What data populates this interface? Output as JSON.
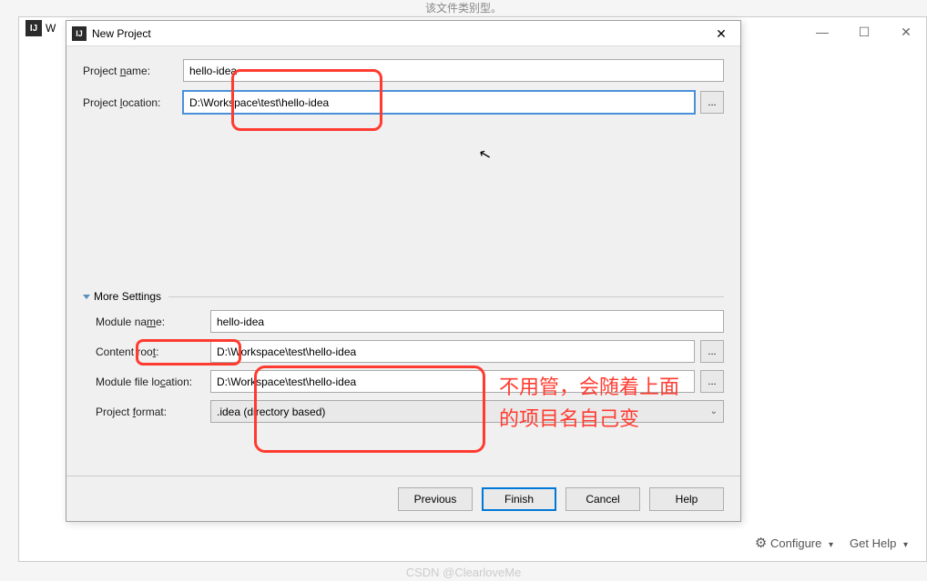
{
  "top_partial_text": "该文件类别型。",
  "outer_window": {
    "partial_title": "W",
    "minimize": "—",
    "maximize": "☐",
    "close": "✕"
  },
  "dialog": {
    "title": "New Project",
    "close": "✕",
    "project_name_label_pre": "Project ",
    "project_name_label_u": "n",
    "project_name_label_post": "ame:",
    "project_name_value": "hello-idea",
    "project_location_label_pre": "Project ",
    "project_location_label_u": "l",
    "project_location_label_post": "ocation:",
    "project_location_value": "D:\\Workspace\\test\\hello-idea",
    "browse": "...",
    "more_settings_pre": "Mor",
    "more_settings_u": "e",
    "more_settings_post": " Settings",
    "module_name_label_pre": "Module na",
    "module_name_label_u": "m",
    "module_name_label_post": "e:",
    "module_name_value": "hello-idea",
    "content_root_label_pre": "Content roo",
    "content_root_label_u": "t",
    "content_root_label_post": ":",
    "content_root_value": "D:\\Workspace\\test\\hello-idea",
    "module_file_loc_label_pre": "Module file lo",
    "module_file_loc_label_u": "c",
    "module_file_loc_label_post": "ation:",
    "module_file_loc_value": "D:\\Workspace\\test\\hello-idea",
    "project_format_label_pre": "Project ",
    "project_format_label_u": "f",
    "project_format_label_post": "ormat:",
    "project_format_value": ".idea (directory based)",
    "buttons": {
      "previous": "Previous",
      "finish": "Finish",
      "cancel": "Cancel",
      "help": "Help"
    }
  },
  "bottom": {
    "configure": "Configure",
    "get_help": "Get Help"
  },
  "watermark": "CSDN @ClearloveMe",
  "annotation_text_line1": "不用管，会随着上面",
  "annotation_text_line2": "的项目名自己变"
}
